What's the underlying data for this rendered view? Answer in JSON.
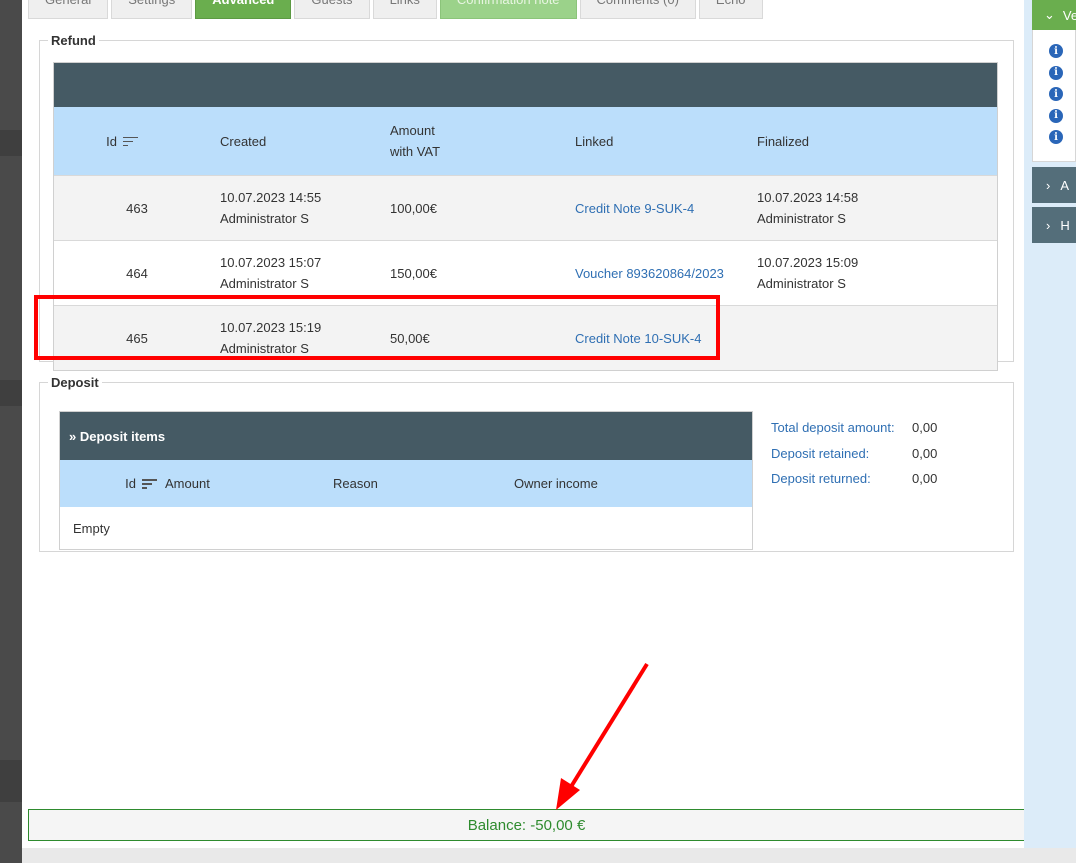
{
  "tabs": [
    {
      "label": "General",
      "state": "normal"
    },
    {
      "label": "Settings",
      "state": "normal"
    },
    {
      "label": "Advanced",
      "state": "active"
    },
    {
      "label": "Guests",
      "state": "normal"
    },
    {
      "label": "Links",
      "state": "normal"
    },
    {
      "label": "Confirmation note",
      "state": "light"
    },
    {
      "label": "Comments (0)",
      "state": "normal"
    },
    {
      "label": "Echo",
      "state": "normal"
    }
  ],
  "refund": {
    "legend": "Refund",
    "columns": {
      "id": "Id",
      "created": "Created",
      "amount_line1": "Amount",
      "amount_line2": "with VAT",
      "linked": "Linked",
      "finalized": "Finalized"
    },
    "rows": [
      {
        "id": "463",
        "created_date": "10.07.2023 14:55",
        "created_by": "Administrator S",
        "amount": "100,00€",
        "linked": "Credit Note 9-SUK-4",
        "final_date": "10.07.2023 14:58",
        "final_by": "Administrator S"
      },
      {
        "id": "464",
        "created_date": "10.07.2023 15:07",
        "created_by": "Administrator S",
        "amount": "150,00€",
        "linked": "Voucher 893620864/2023",
        "final_date": "10.07.2023 15:09",
        "final_by": "Administrator S"
      },
      {
        "id": "465",
        "created_date": "10.07.2023 15:19",
        "created_by": "Administrator S",
        "amount": "50,00€",
        "linked": "Credit Note 10-SUK-4",
        "final_date": "",
        "final_by": ""
      }
    ]
  },
  "deposit": {
    "legend": "Deposit",
    "header": "» Deposit items",
    "columns": {
      "id": "Id",
      "amount": "Amount",
      "reason": "Reason",
      "owner_income": "Owner income"
    },
    "empty_text": "Empty",
    "summary": [
      {
        "label": "Total deposit amount:",
        "value": "0,00"
      },
      {
        "label": "Deposit retained:",
        "value": "0,00"
      },
      {
        "label": "Deposit returned:",
        "value": "0,00"
      }
    ]
  },
  "balance": {
    "text": "Balance: -50,00 €",
    "color": "#2e8b2e"
  },
  "right_panel": {
    "green_label": "Ve",
    "dark_items": [
      "A",
      "H"
    ],
    "info_icon_count": 5
  },
  "colors": {
    "accent_green": "#6aae4e",
    "header_dark": "#455a64",
    "header_light": "#bbdefb",
    "link": "#2f6fb3",
    "annotation_red": "#ff0000"
  }
}
